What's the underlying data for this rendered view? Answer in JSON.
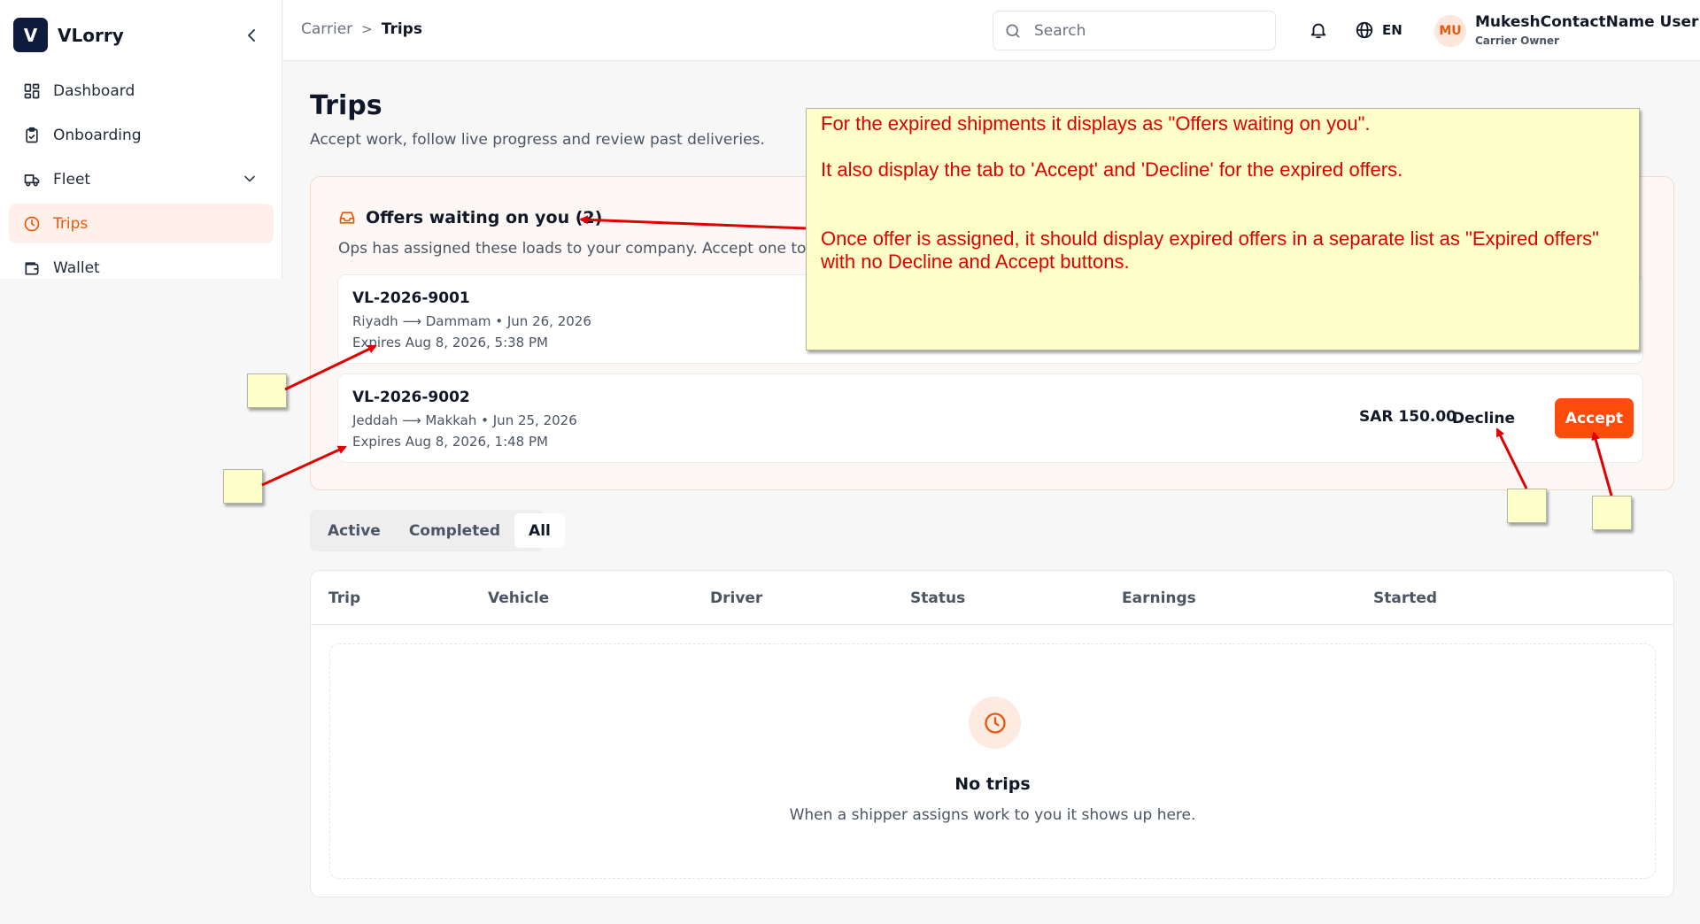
{
  "brand": {
    "logo_letter": "V",
    "name": "VLorry"
  },
  "sidebar": {
    "items": [
      {
        "label": "Dashboard",
        "icon": "grid-icon"
      },
      {
        "label": "Onboarding",
        "icon": "clipboard-icon"
      },
      {
        "label": "Fleet",
        "icon": "truck-icon"
      },
      {
        "label": "Trips",
        "icon": "clock-icon"
      },
      {
        "label": "Wallet",
        "icon": "wallet-icon"
      }
    ],
    "active": "Trips"
  },
  "header": {
    "breadcrumb": {
      "parent": "Carrier",
      "separator": ">",
      "current": "Trips"
    },
    "search_placeholder": "Search",
    "language": "EN",
    "user": {
      "initials": "MU",
      "name": "MukeshContactName User",
      "role": "Carrier Owner"
    }
  },
  "page": {
    "title": "Trips",
    "subtitle": "Accept work, follow live progress and review past deliveries."
  },
  "offers": {
    "heading": "Offers waiting on you (2)",
    "description": "Ops has assigned these loads to your company. Accept one to tur",
    "items": [
      {
        "id": "VL-2026-9001",
        "route": "Riyadh ⟶ Dammam • Jun 26, 2026",
        "expires": "Expires Aug 8, 2026, 5:38 PM"
      },
      {
        "id": "VL-2026-9002",
        "route": "Jeddah ⟶ Makkah • Jun 25, 2026",
        "expires": "Expires Aug 8, 2026, 1:48 PM",
        "price": "SAR 150.00",
        "decline_label": "Decline",
        "accept_label": "Accept"
      }
    ]
  },
  "tabs": [
    {
      "label": "Active"
    },
    {
      "label": "Completed"
    },
    {
      "label": "All"
    }
  ],
  "active_tab": "All",
  "table": {
    "columns": [
      "Trip",
      "Vehicle",
      "Driver",
      "Status",
      "Earnings",
      "Started"
    ],
    "rows": [],
    "empty": {
      "title": "No trips",
      "description": "When a shipper assigns work to you it shows up here."
    }
  },
  "annotation": {
    "line1": "For the expired shipments it displays as \"Offers waiting on you\".",
    "line2": "It also display the tab to 'Accept' and 'Decline' for the expired offers.",
    "line3": "Once offer is assigned, it should display expired offers in a separate list as \"Expired offers\" with no Decline and Accept buttons."
  },
  "colors": {
    "accent": "#ea580c",
    "accept_button": "#fb4c0a",
    "annotation_text": "#e00000",
    "annotation_bg": "#ffffc9"
  }
}
